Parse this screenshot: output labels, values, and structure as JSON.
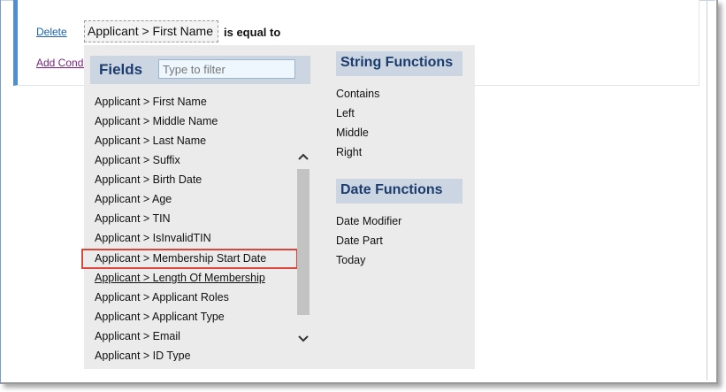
{
  "condition": {
    "delete_label": "Delete",
    "field_value": "Applicant > First Name",
    "operator": "is equal to",
    "add_label": "Add Condi"
  },
  "fields_panel": {
    "title": "Fields",
    "filter_placeholder": "Type to filter",
    "items": [
      "Applicant > First Name",
      "Applicant > Middle Name",
      "Applicant > Last Name",
      "Applicant > Suffix",
      "Applicant > Birth Date",
      "Applicant > Age",
      "Applicant > TIN",
      "Applicant > IsInvalidTIN",
      "Applicant > Membership Start Date",
      "Applicant > Length Of Membership",
      "Applicant > Applicant Roles",
      "Applicant > Applicant Type",
      "Applicant > Email",
      "Applicant > ID Type"
    ],
    "highlighted_item": "Applicant > Membership Start Date",
    "hovered_item": "Applicant > Length Of Membership"
  },
  "string_functions": {
    "title": "String Functions",
    "items": [
      "Contains",
      "Left",
      "Middle",
      "Right"
    ]
  },
  "date_functions": {
    "title": "Date Functions",
    "items": [
      "Date Modifier",
      "Date Part",
      "Today"
    ]
  },
  "icons": {
    "scroll_up": "chevron-up-icon",
    "scroll_down": "chevron-down-icon"
  },
  "colors": {
    "accent_border": "#4f8fd0",
    "header_bg": "#ccd6e2",
    "header_text": "#1c3c6e",
    "highlight_border": "#d9463b",
    "link": "#1b61b5",
    "visited_link": "#7a1f7f"
  }
}
